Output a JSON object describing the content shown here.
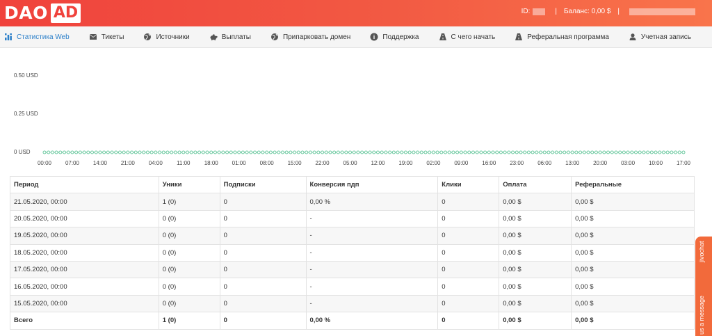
{
  "header": {
    "logo_main": "DAO",
    "logo_accent": "AD",
    "id_label": "ID:",
    "balance_label": "Баланс: 0,00 $",
    "separator": "|"
  },
  "nav": {
    "items": [
      {
        "label": "Статистика Web",
        "icon": "bar-chart-icon",
        "active": true
      },
      {
        "label": "Тикеты",
        "icon": "envelope-icon"
      },
      {
        "label": "Источники",
        "icon": "globe-icon"
      },
      {
        "label": "Выплаты",
        "icon": "piggy-bank-icon"
      },
      {
        "label": "Припарковать домен",
        "icon": "globe-icon"
      },
      {
        "label": "Поддержка",
        "icon": "info-icon"
      },
      {
        "label": "С чего начать",
        "icon": "road-icon"
      },
      {
        "label": "Реферальная программа",
        "icon": "road-icon"
      },
      {
        "label": "Учетная запись",
        "icon": "user-icon"
      }
    ]
  },
  "chart_data": {
    "type": "line",
    "y_ticks": [
      "0.50 USD",
      "0.25 USD",
      "0 USD"
    ],
    "ylim": [
      0,
      0.5
    ],
    "x_ticks": [
      "00:00",
      "07:00",
      "14:00",
      "21:00",
      "04:00",
      "11:00",
      "18:00",
      "01:00",
      "08:00",
      "15:00",
      "22:00",
      "05:00",
      "12:00",
      "19:00",
      "02:00",
      "09:00",
      "16:00",
      "23:00",
      "06:00",
      "13:00",
      "20:00",
      "03:00",
      "10:00",
      "17:00"
    ],
    "point_count": 162,
    "series": [
      {
        "values_constant": 0
      }
    ],
    "line_color": "#6cc9a0"
  },
  "table": {
    "headers": [
      "Период",
      "Уники",
      "Подписки",
      "Конверсия пдп",
      "Клики",
      "Оплата",
      "Реферальные"
    ],
    "rows": [
      [
        "21.05.2020, 00:00",
        "1 (0)",
        "0",
        "0,00 %",
        "0",
        "0,00 $",
        "0,00 $"
      ],
      [
        "20.05.2020, 00:00",
        "0 (0)",
        "0",
        "-",
        "0",
        "0,00 $",
        "0,00 $"
      ],
      [
        "19.05.2020, 00:00",
        "0 (0)",
        "0",
        "-",
        "0",
        "0,00 $",
        "0,00 $"
      ],
      [
        "18.05.2020, 00:00",
        "0 (0)",
        "0",
        "-",
        "0",
        "0,00 $",
        "0,00 $"
      ],
      [
        "17.05.2020, 00:00",
        "0 (0)",
        "0",
        "-",
        "0",
        "0,00 $",
        "0,00 $"
      ],
      [
        "16.05.2020, 00:00",
        "0 (0)",
        "0",
        "-",
        "0",
        "0,00 $",
        "0,00 $"
      ],
      [
        "15.05.2020, 00:00",
        "0 (0)",
        "0",
        "-",
        "0",
        "0,00 $",
        "0,00 $"
      ]
    ],
    "footer": [
      "Всего",
      "1 (0)",
      "0",
      "0,00 %",
      "0",
      "0,00 $",
      "0,00 $"
    ]
  },
  "chat": {
    "brand": "jivochat",
    "cta": "us a message"
  },
  "colors": {
    "header_start": "#f0423c",
    "header_end": "#f9744b",
    "active_nav": "#2b7fc9",
    "chat_tab": "#f26a3b"
  }
}
